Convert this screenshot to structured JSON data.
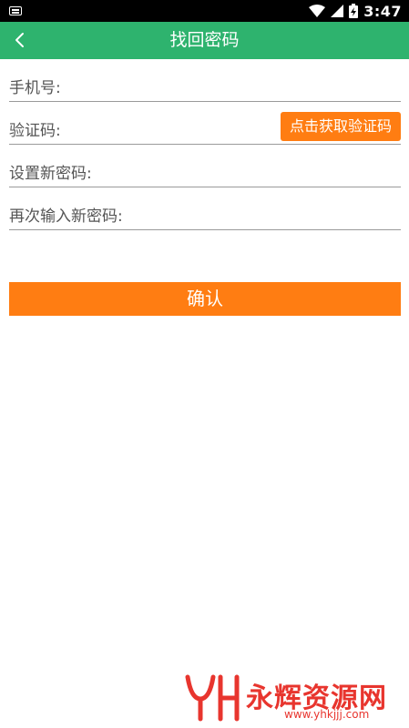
{
  "status_bar": {
    "time": "3:47",
    "icons": [
      "keyboard-icon",
      "wifi-icon",
      "signal-icon",
      "battery-charging-icon"
    ]
  },
  "app_bar": {
    "title": "找回密码",
    "back_icon": "chevron-left-icon",
    "color": "#2eb36e"
  },
  "form": {
    "phone_label": "手机号:",
    "phone_value": "",
    "code_label": "验证码:",
    "code_value": "",
    "get_code_label": "点击获取验证码",
    "new_password_label": "设置新密码:",
    "new_password_value": "",
    "confirm_password_label": "再次输入新密码:",
    "confirm_password_value": ""
  },
  "confirm_button": {
    "label": "确认",
    "color": "#ff7d12"
  },
  "watermark": {
    "text": "永辉资源网",
    "url": "www.yhkjjj.com"
  }
}
